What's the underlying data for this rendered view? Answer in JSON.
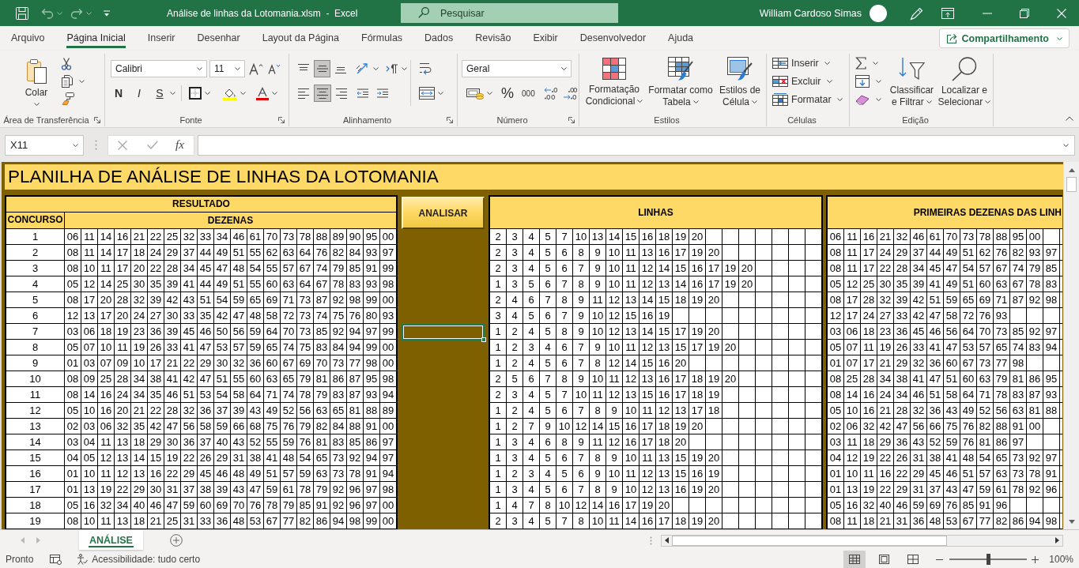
{
  "title_bar": {
    "title": "Análise de linhas da Lotomania.xlsm  -  Excel",
    "search": {
      "placeholder": "Pesquisar"
    },
    "user": "William Cardoso Simas"
  },
  "ribbon": {
    "tabs": [
      {
        "label": "Arquivo",
        "selected": false
      },
      {
        "label": "Página Inicial",
        "selected": true
      },
      {
        "label": "Inserir",
        "selected": false
      },
      {
        "label": "Desenhar",
        "selected": false
      },
      {
        "label": "Layout da Página",
        "selected": false
      },
      {
        "label": "Fórmulas",
        "selected": false
      },
      {
        "label": "Dados",
        "selected": false
      },
      {
        "label": "Revisão",
        "selected": false
      },
      {
        "label": "Exibir",
        "selected": false
      },
      {
        "label": "Desenvolvedor",
        "selected": false
      },
      {
        "label": "Ajuda",
        "selected": false
      }
    ],
    "share_button": "Compartilhamento",
    "clipboard": {
      "label": "Área de Transferência",
      "paste": "Colar"
    },
    "font": {
      "label": "Fonte",
      "name": "Calibri",
      "size": "11",
      "bold": "N",
      "italic": "I",
      "underline": "S"
    },
    "alignment": {
      "label": "Alinhamento",
      "vertical": [
        {
          "kind": "top",
          "selected": false
        },
        {
          "kind": "middle",
          "selected": true
        },
        {
          "kind": "bottom",
          "selected": false
        }
      ],
      "horizontal": [
        {
          "kind": "left",
          "selected": false
        },
        {
          "kind": "center",
          "selected": true
        },
        {
          "kind": "right",
          "selected": false
        }
      ]
    },
    "number": {
      "label": "Número",
      "format": "Geral",
      "percent": "%",
      "thousands": "000"
    },
    "styles": {
      "label": "Estilos",
      "buttons": [
        "Formatação Condicional",
        "Formatar como Tabela",
        "Estilos de Célula"
      ]
    },
    "cells": {
      "label": "Células",
      "buttons": [
        "Inserir",
        "Excluir",
        "Formatar"
      ]
    },
    "editing": {
      "label": "Edição",
      "buttons": [
        "Classificar e Filtrar",
        "Localizar e Selecionar"
      ]
    }
  },
  "formula_bar": {
    "name_box": "X11",
    "function_button": "fx"
  },
  "sheet": {
    "title": "PLANILHA DE ANÁLISE DE LINHAS DA LOTOMANIA",
    "resultado": {
      "heading": "RESULTADO",
      "columns": [
        "CONCURSO",
        "DEZENAS"
      ],
      "rows": [
        {
          "concurso": "1",
          "dezenas": [
            "06",
            "11",
            "14",
            "16",
            "21",
            "22",
            "25",
            "32",
            "33",
            "34",
            "46",
            "61",
            "70",
            "73",
            "78",
            "88",
            "89",
            "90",
            "95",
            "00"
          ]
        },
        {
          "concurso": "2",
          "dezenas": [
            "08",
            "11",
            "14",
            "17",
            "18",
            "24",
            "29",
            "37",
            "44",
            "49",
            "51",
            "55",
            "62",
            "63",
            "64",
            "76",
            "82",
            "84",
            "93",
            "97"
          ]
        },
        {
          "concurso": "3",
          "dezenas": [
            "08",
            "10",
            "11",
            "17",
            "20",
            "22",
            "28",
            "34",
            "45",
            "47",
            "48",
            "54",
            "55",
            "57",
            "67",
            "74",
            "79",
            "85",
            "91",
            "99"
          ]
        },
        {
          "concurso": "4",
          "dezenas": [
            "05",
            "12",
            "14",
            "25",
            "30",
            "35",
            "39",
            "41",
            "44",
            "49",
            "51",
            "55",
            "60",
            "63",
            "64",
            "67",
            "78",
            "83",
            "93",
            "98"
          ]
        },
        {
          "concurso": "5",
          "dezenas": [
            "08",
            "17",
            "20",
            "28",
            "32",
            "39",
            "42",
            "43",
            "51",
            "54",
            "59",
            "65",
            "69",
            "71",
            "73",
            "87",
            "92",
            "98",
            "99",
            "00"
          ]
        },
        {
          "concurso": "6",
          "dezenas": [
            "12",
            "13",
            "17",
            "20",
            "24",
            "27",
            "30",
            "33",
            "35",
            "42",
            "47",
            "48",
            "58",
            "72",
            "73",
            "74",
            "75",
            "76",
            "80",
            "93"
          ]
        },
        {
          "concurso": "7",
          "dezenas": [
            "03",
            "06",
            "18",
            "19",
            "23",
            "36",
            "39",
            "45",
            "46",
            "50",
            "56",
            "59",
            "64",
            "70",
            "73",
            "85",
            "92",
            "94",
            "97",
            "99"
          ]
        },
        {
          "concurso": "8",
          "dezenas": [
            "05",
            "07",
            "10",
            "11",
            "19",
            "26",
            "33",
            "41",
            "47",
            "53",
            "57",
            "59",
            "65",
            "74",
            "75",
            "83",
            "84",
            "94",
            "99",
            "00"
          ]
        },
        {
          "concurso": "9",
          "dezenas": [
            "01",
            "03",
            "07",
            "09",
            "10",
            "17",
            "21",
            "22",
            "29",
            "30",
            "32",
            "36",
            "60",
            "67",
            "69",
            "70",
            "73",
            "77",
            "98",
            "00"
          ]
        },
        {
          "concurso": "10",
          "dezenas": [
            "08",
            "09",
            "25",
            "28",
            "34",
            "38",
            "41",
            "42",
            "47",
            "51",
            "55",
            "60",
            "63",
            "65",
            "79",
            "81",
            "86",
            "87",
            "95",
            "98"
          ]
        },
        {
          "concurso": "11",
          "dezenas": [
            "08",
            "14",
            "16",
            "24",
            "34",
            "35",
            "46",
            "51",
            "53",
            "54",
            "58",
            "64",
            "71",
            "74",
            "78",
            "79",
            "83",
            "87",
            "93",
            "94"
          ]
        },
        {
          "concurso": "12",
          "dezenas": [
            "05",
            "10",
            "16",
            "20",
            "21",
            "22",
            "28",
            "32",
            "36",
            "37",
            "39",
            "43",
            "49",
            "52",
            "56",
            "63",
            "65",
            "81",
            "88",
            "89"
          ]
        },
        {
          "concurso": "13",
          "dezenas": [
            "02",
            "03",
            "06",
            "32",
            "35",
            "42",
            "47",
            "56",
            "58",
            "59",
            "66",
            "68",
            "75",
            "76",
            "79",
            "82",
            "84",
            "88",
            "91",
            "00"
          ]
        },
        {
          "concurso": "14",
          "dezenas": [
            "03",
            "04",
            "11",
            "13",
            "18",
            "29",
            "30",
            "36",
            "37",
            "40",
            "43",
            "52",
            "55",
            "59",
            "76",
            "81",
            "83",
            "85",
            "86",
            "97"
          ]
        },
        {
          "concurso": "15",
          "dezenas": [
            "04",
            "05",
            "12",
            "13",
            "14",
            "15",
            "19",
            "22",
            "26",
            "29",
            "31",
            "38",
            "41",
            "48",
            "54",
            "65",
            "73",
            "92",
            "94",
            "97"
          ]
        },
        {
          "concurso": "16",
          "dezenas": [
            "01",
            "10",
            "11",
            "12",
            "13",
            "16",
            "22",
            "29",
            "45",
            "46",
            "48",
            "49",
            "51",
            "57",
            "59",
            "63",
            "73",
            "78",
            "91",
            "94"
          ]
        },
        {
          "concurso": "17",
          "dezenas": [
            "01",
            "13",
            "19",
            "22",
            "29",
            "30",
            "31",
            "37",
            "38",
            "39",
            "43",
            "47",
            "59",
            "61",
            "78",
            "79",
            "92",
            "96",
            "97",
            "98"
          ]
        },
        {
          "concurso": "18",
          "dezenas": [
            "05",
            "16",
            "32",
            "34",
            "40",
            "46",
            "47",
            "59",
            "60",
            "69",
            "70",
            "76",
            "78",
            "79",
            "85",
            "91",
            "92",
            "96",
            "97",
            "00"
          ]
        },
        {
          "concurso": "19",
          "dezenas": [
            "08",
            "10",
            "11",
            "13",
            "18",
            "21",
            "25",
            "31",
            "33",
            "36",
            "48",
            "53",
            "67",
            "77",
            "82",
            "86",
            "94",
            "98",
            "99",
            "00"
          ]
        }
      ]
    },
    "analisar": {
      "button": "ANALISAR",
      "cells": [
        {
          "selected": false
        },
        {
          "selected": false
        },
        {
          "selected": false
        },
        {
          "selected": false
        },
        {
          "selected": false
        },
        {
          "selected": false
        },
        {
          "selected": true
        },
        {
          "selected": false
        },
        {
          "selected": false
        },
        {
          "selected": false
        },
        {
          "selected": false
        },
        {
          "selected": false
        },
        {
          "selected": false
        },
        {
          "selected": false
        },
        {
          "selected": false
        },
        {
          "selected": false
        },
        {
          "selected": false
        },
        {
          "selected": false
        },
        {
          "selected": false
        }
      ]
    },
    "linhas": {
      "heading": "LINHAS",
      "rows": [
        [
          "2",
          "3",
          "4",
          "5",
          "7",
          "10",
          "13",
          "14",
          "15",
          "16",
          "18",
          "19",
          "20"
        ],
        [
          "2",
          "3",
          "4",
          "5",
          "6",
          "8",
          "9",
          "10",
          "11",
          "13",
          "16",
          "17",
          "19",
          "20"
        ],
        [
          "2",
          "3",
          "4",
          "5",
          "6",
          "7",
          "9",
          "10",
          "11",
          "12",
          "14",
          "15",
          "16",
          "17",
          "19",
          "20"
        ],
        [
          "1",
          "3",
          "5",
          "6",
          "7",
          "8",
          "9",
          "10",
          "11",
          "12",
          "13",
          "14",
          "16",
          "17",
          "19",
          "20"
        ],
        [
          "2",
          "4",
          "6",
          "7",
          "8",
          "9",
          "11",
          "12",
          "13",
          "14",
          "15",
          "18",
          "19",
          "20"
        ],
        [
          "3",
          "4",
          "5",
          "6",
          "7",
          "9",
          "10",
          "12",
          "15",
          "16",
          "19"
        ],
        [
          "1",
          "2",
          "4",
          "5",
          "8",
          "9",
          "10",
          "12",
          "13",
          "14",
          "15",
          "17",
          "19",
          "20"
        ],
        [
          "1",
          "2",
          "3",
          "4",
          "6",
          "7",
          "9",
          "10",
          "11",
          "12",
          "13",
          "15",
          "17",
          "19",
          "20"
        ],
        [
          "1",
          "2",
          "4",
          "5",
          "6",
          "7",
          "8",
          "12",
          "14",
          "15",
          "16",
          "20"
        ],
        [
          "2",
          "5",
          "6",
          "7",
          "8",
          "9",
          "10",
          "11",
          "12",
          "13",
          "16",
          "17",
          "18",
          "19",
          "20"
        ],
        [
          "2",
          "3",
          "4",
          "5",
          "7",
          "10",
          "11",
          "12",
          "13",
          "15",
          "16",
          "17",
          "18",
          "19"
        ],
        [
          "1",
          "2",
          "4",
          "5",
          "6",
          "7",
          "8",
          "9",
          "10",
          "11",
          "12",
          "13",
          "17",
          "18"
        ],
        [
          "1",
          "2",
          "7",
          "9",
          "10",
          "12",
          "14",
          "15",
          "16",
          "17",
          "18",
          "19",
          "20"
        ],
        [
          "1",
          "3",
          "4",
          "6",
          "8",
          "9",
          "11",
          "12",
          "16",
          "17",
          "18",
          "20"
        ],
        [
          "1",
          "3",
          "4",
          "5",
          "6",
          "7",
          "8",
          "9",
          "10",
          "11",
          "13",
          "15",
          "19",
          "20"
        ],
        [
          "1",
          "2",
          "3",
          "4",
          "5",
          "6",
          "9",
          "10",
          "11",
          "12",
          "13",
          "15",
          "16",
          "19"
        ],
        [
          "1",
          "3",
          "4",
          "5",
          "6",
          "7",
          "8",
          "9",
          "10",
          "12",
          "13",
          "16",
          "19",
          "20"
        ],
        [
          "1",
          "4",
          "7",
          "8",
          "10",
          "12",
          "14",
          "16",
          "17",
          "19",
          "20"
        ],
        [
          "2",
          "3",
          "4",
          "5",
          "7",
          "8",
          "10",
          "11",
          "14",
          "16",
          "17",
          "18",
          "19",
          "20"
        ]
      ]
    },
    "primeiras_dezenas": {
      "heading": "PRIMEIRAS DEZENAS DAS LINH",
      "rows": [
        [
          "06",
          "11",
          "16",
          "21",
          "32",
          "46",
          "61",
          "70",
          "73",
          "78",
          "88",
          "95",
          "00"
        ],
        [
          "08",
          "11",
          "17",
          "24",
          "29",
          "37",
          "44",
          "49",
          "51",
          "62",
          "76",
          "82",
          "93",
          "97"
        ],
        [
          "08",
          "11",
          "17",
          "22",
          "28",
          "34",
          "45",
          "47",
          "54",
          "57",
          "67",
          "74",
          "79",
          "85"
        ],
        [
          "05",
          "12",
          "25",
          "30",
          "35",
          "39",
          "41",
          "49",
          "51",
          "60",
          "63",
          "67",
          "78",
          "83"
        ],
        [
          "08",
          "17",
          "28",
          "32",
          "39",
          "42",
          "51",
          "59",
          "65",
          "69",
          "71",
          "87",
          "92",
          "98"
        ],
        [
          "12",
          "17",
          "24",
          "27",
          "33",
          "42",
          "47",
          "58",
          "72",
          "76",
          "93"
        ],
        [
          "03",
          "06",
          "18",
          "23",
          "36",
          "45",
          "46",
          "56",
          "64",
          "70",
          "73",
          "85",
          "92",
          "97"
        ],
        [
          "05",
          "07",
          "11",
          "19",
          "26",
          "33",
          "41",
          "47",
          "53",
          "57",
          "65",
          "74",
          "83",
          "94"
        ],
        [
          "01",
          "07",
          "17",
          "21",
          "29",
          "32",
          "36",
          "60",
          "67",
          "73",
          "77",
          "98"
        ],
        [
          "08",
          "25",
          "28",
          "34",
          "38",
          "41",
          "47",
          "51",
          "60",
          "63",
          "79",
          "81",
          "86",
          "95"
        ],
        [
          "08",
          "14",
          "16",
          "24",
          "34",
          "46",
          "51",
          "58",
          "64",
          "71",
          "78",
          "83",
          "87",
          "93"
        ],
        [
          "05",
          "10",
          "16",
          "21",
          "28",
          "32",
          "36",
          "43",
          "49",
          "52",
          "56",
          "63",
          "81",
          "88"
        ],
        [
          "02",
          "06",
          "32",
          "42",
          "47",
          "56",
          "66",
          "75",
          "76",
          "82",
          "88",
          "91",
          "00"
        ],
        [
          "03",
          "11",
          "18",
          "29",
          "36",
          "43",
          "52",
          "59",
          "76",
          "81",
          "86",
          "97"
        ],
        [
          "04",
          "12",
          "19",
          "22",
          "26",
          "31",
          "38",
          "41",
          "48",
          "54",
          "65",
          "73",
          "92",
          "97"
        ],
        [
          "01",
          "10",
          "11",
          "16",
          "22",
          "29",
          "45",
          "46",
          "51",
          "57",
          "63",
          "73",
          "78",
          "91"
        ],
        [
          "01",
          "13",
          "19",
          "22",
          "29",
          "31",
          "37",
          "43",
          "47",
          "59",
          "61",
          "78",
          "92",
          "96"
        ],
        [
          "05",
          "16",
          "32",
          "40",
          "46",
          "59",
          "69",
          "76",
          "85",
          "91",
          "96"
        ],
        [
          "08",
          "11",
          "18",
          "21",
          "31",
          "36",
          "48",
          "53",
          "67",
          "77",
          "82",
          "86",
          "94",
          "98"
        ]
      ]
    }
  },
  "sheet_tabs": [
    {
      "label": "ANÁLISE",
      "selected": true
    }
  ],
  "status_bar": {
    "status": "Pronto",
    "accessibility": "Acessibilidade: tudo certo",
    "views": [
      {
        "kind": "normal",
        "selected": true
      },
      {
        "kind": "page_layout",
        "selected": false
      },
      {
        "kind": "page_break",
        "selected": false
      }
    ],
    "zoom": {
      "level": 0.5,
      "reading": "100%"
    }
  }
}
